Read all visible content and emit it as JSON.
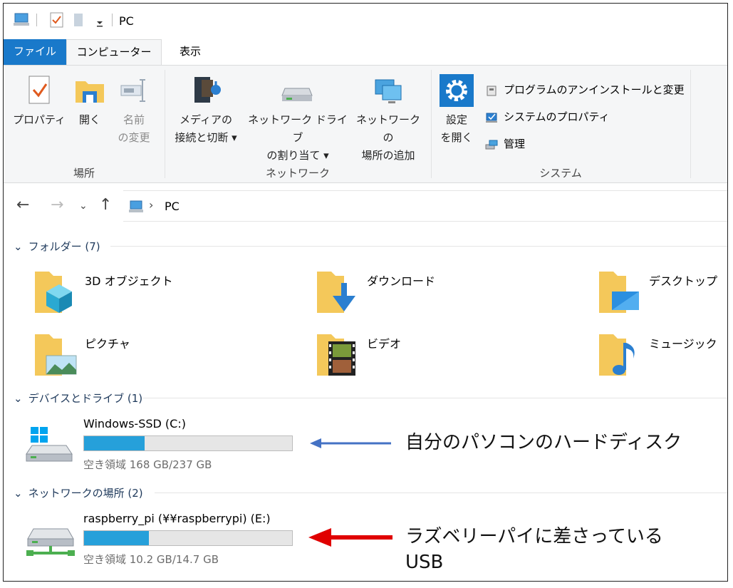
{
  "window": {
    "title": "PC"
  },
  "ribbon_tabs": [
    "ファイル",
    "コンピューター",
    "表示"
  ],
  "ribbon": {
    "location_group": {
      "label": "場所",
      "properties": "プロパティ",
      "open": "開く",
      "rename_line1": "名前",
      "rename_line2": "の変更"
    },
    "network_group": {
      "label": "ネットワーク",
      "media_line1": "メディアの",
      "media_line2": "接続と切断",
      "map_drive_line1": "ネットワーク ドライブ",
      "map_drive_line2": "の割り当て",
      "add_location_line1": "ネットワークの",
      "add_location_line2": "場所の追加"
    },
    "system_group": {
      "label": "システム",
      "settings_line1": "設定",
      "settings_line2": "を開く",
      "uninstall": "プログラムのアンインストールと変更",
      "sys_props": "システムのプロパティ",
      "manage": "管理"
    }
  },
  "address": {
    "path": "PC"
  },
  "sections": {
    "folders": {
      "title": "フォルダー (7)"
    },
    "devices": {
      "title": "デバイスとドライブ (1)"
    },
    "network": {
      "title": "ネットワークの場所 (2)"
    }
  },
  "folders": [
    {
      "name": "3D オブジェクト",
      "icon": "3d-objects-icon"
    },
    {
      "name": "ダウンロード",
      "icon": "downloads-icon"
    },
    {
      "name": "デスクトップ",
      "icon": "desktop-icon"
    },
    {
      "name": "ピクチャ",
      "icon": "pictures-icon"
    },
    {
      "name": "ビデオ",
      "icon": "videos-icon"
    },
    {
      "name": "ミュージック",
      "icon": "music-icon"
    }
  ],
  "drives": [
    {
      "name": "Windows-SSD (C:)",
      "space": "空き領域 168 GB/237 GB",
      "used_fraction": 0.29
    },
    {
      "name": "raspberry_pi (¥¥raspberrypi) (E:)",
      "space": "空き領域 10.2 GB/14.7 GB",
      "used_fraction": 0.31
    }
  ],
  "annotations": {
    "hdd": "自分のパソコンのハードディスク",
    "usb_line1": "ラズベリーパイに差さっている",
    "usb_line2": "USB"
  },
  "colors": {
    "accent": "#1979ca",
    "bar_fill": "#26a0da",
    "blue_arrow": "#4472c4",
    "red_arrow": "#e00000"
  }
}
